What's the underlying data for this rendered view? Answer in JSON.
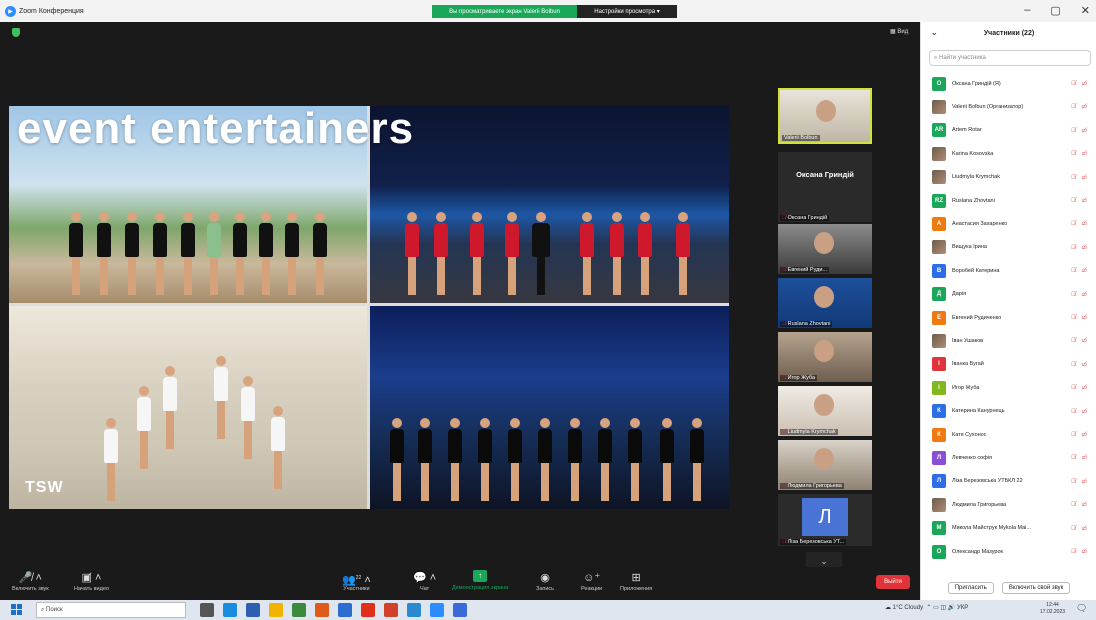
{
  "window": {
    "title": "Zoom Конференция",
    "controls": [
      "–",
      "▢",
      "✕"
    ]
  },
  "banner": {
    "sharing": "Вы просматриваете экран Valerii Bolbun",
    "view_options": "Настройки просмотра ▾"
  },
  "stage": {
    "view_label": "Вид"
  },
  "shared_screen": {
    "headline": "event entertainers",
    "watermark": "TSW"
  },
  "filmstrip": {
    "active_speaker_label": "Valerii Bolbun",
    "speaker_name": "Оксана Гриндій",
    "speaker_sub": "Оксана Гриндій",
    "tiles": [
      {
        "name": "Евгений Руди..."
      },
      {
        "name": "Ruslana Zhovtani"
      },
      {
        "name": "Игор Жуба"
      },
      {
        "name": "Liudmyla Krymchak"
      },
      {
        "name": "Людмила Григорьева"
      },
      {
        "name": "Ліза Березовська УТ...",
        "letter": "Л"
      }
    ]
  },
  "toolbar": {
    "items": [
      {
        "label": "Включить звук",
        "icon": "mic-muted-icon"
      },
      {
        "label": "Начать видео",
        "icon": "camera-off-icon"
      },
      {
        "label": "Участники",
        "icon": "participants-icon",
        "count": "22"
      },
      {
        "label": "Чат",
        "icon": "chat-icon"
      },
      {
        "label": "Демонстрация экрана",
        "icon": "share-screen-icon"
      },
      {
        "label": "Запись",
        "icon": "record-icon"
      },
      {
        "label": "Реакции",
        "icon": "reactions-icon"
      },
      {
        "label": "Приложения",
        "icon": "apps-icon"
      }
    ],
    "leave": "Выйти"
  },
  "participants": {
    "title": "Участники (22)",
    "search_placeholder": "Найти участника",
    "list": [
      {
        "initials": "О",
        "color": "#1ba75a",
        "name": "Оксана Гриндій (Я)"
      },
      {
        "initials": "",
        "color": "photo",
        "name": "Valerii Bolbun (Организатор)"
      },
      {
        "initials": "AR",
        "color": "#1ba75a",
        "name": "Artem Rotar"
      },
      {
        "initials": "",
        "color": "photo",
        "name": "Karina Kosovska"
      },
      {
        "initials": "",
        "color": "photo",
        "name": "Liudmyla Krymchak"
      },
      {
        "initials": "RZ",
        "color": "#1ba75a",
        "name": "Ruslana Zhovtani"
      },
      {
        "initials": "А",
        "color": "#f07a12",
        "name": "Анастасия Захаренко"
      },
      {
        "initials": "",
        "color": "photo",
        "name": "Вищука Ірина"
      },
      {
        "initials": "В",
        "color": "#2d6ee8",
        "name": "Воробей Катерина"
      },
      {
        "initials": "Д",
        "color": "#1ba75a",
        "name": "Дарія"
      },
      {
        "initials": "Е",
        "color": "#f07a12",
        "name": "Евгений Рудиченко"
      },
      {
        "initials": "",
        "color": "photo",
        "name": "Іван Ушаков"
      },
      {
        "initials": "І",
        "color": "#e0343a",
        "name": "Іванка Бугай"
      },
      {
        "initials": "І",
        "color": "#82b81e",
        "name": "Игор Жуба"
      },
      {
        "initials": "К",
        "color": "#2d6ee8",
        "name": "Катерина Канурнець"
      },
      {
        "initials": "К",
        "color": "#f07a12",
        "name": "Катя Сухонос"
      },
      {
        "initials": "Л",
        "color": "#8a4fd6",
        "name": "Левченко софія"
      },
      {
        "initials": "Л",
        "color": "#2d6ee8",
        "name": "Ліза Березовська УТБКЛ 22"
      },
      {
        "initials": "",
        "color": "photo",
        "name": "Людмила Григорьева"
      },
      {
        "initials": "М",
        "color": "#1ba75a",
        "name": "Микола Майструк Mykola Mai..."
      },
      {
        "initials": "О",
        "color": "#1ba75a",
        "name": "Олександр Мазурок"
      }
    ],
    "invite": "Пригласить",
    "unmute_me": "Включить свой звук"
  },
  "taskbar": {
    "search": "Поиск",
    "weather": "1°C Cloudy",
    "lang": "УКР",
    "time": "12:44",
    "date": "17.02.2023"
  }
}
